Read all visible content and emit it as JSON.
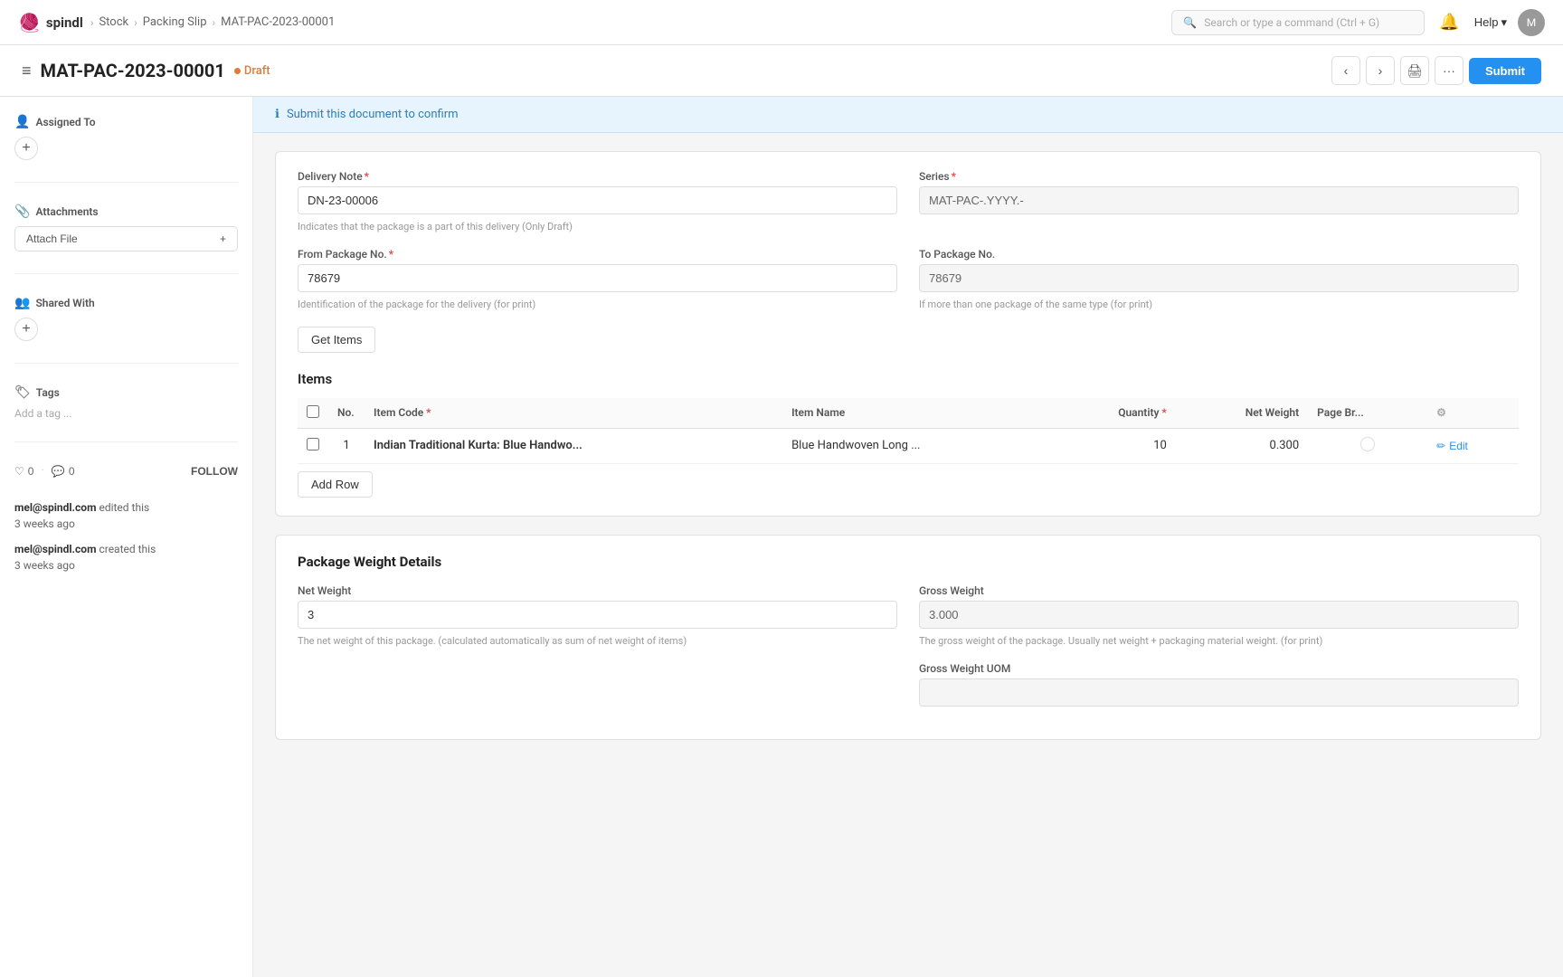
{
  "topnav": {
    "logo_text": "spindl",
    "logo_icon": "🧶",
    "breadcrumb": [
      {
        "label": "Stock",
        "href": "#"
      },
      {
        "label": "Packing Slip",
        "href": "#"
      },
      {
        "label": "MAT-PAC-2023-00001",
        "href": "#"
      }
    ],
    "search_placeholder": "Search or type a command (Ctrl + G)",
    "help_label": "Help",
    "avatar_text": "M"
  },
  "page_header": {
    "title": "MAT-PAC-2023-00001",
    "status": "Draft",
    "submit_label": "Submit"
  },
  "sidebar": {
    "assigned_to_label": "Assigned To",
    "attachments_label": "Attachments",
    "attach_file_label": "Attach File",
    "shared_with_label": "Shared With",
    "tags_label": "Tags",
    "add_tag_placeholder": "Add a tag ...",
    "likes_count": "0",
    "comments_count": "0",
    "follow_label": "FOLLOW",
    "activity": [
      {
        "user": "mel@spindl.com",
        "action": "edited this",
        "time": "3 weeks ago"
      },
      {
        "user": "mel@spindl.com",
        "action": "created this",
        "time": "3 weeks ago"
      }
    ]
  },
  "notice": {
    "text": "Submit this document to confirm"
  },
  "delivery_note": {
    "label": "Delivery Note",
    "value": "DN-23-00006",
    "hint": "Indicates that the package is a part of this delivery (Only Draft)"
  },
  "series": {
    "label": "Series",
    "value": "MAT-PAC-.YYYY.-"
  },
  "from_package_no": {
    "label": "From Package No.",
    "value": "78679",
    "hint": "Identification of the package for the delivery (for print)"
  },
  "to_package_no": {
    "label": "To Package No.",
    "value": "78679",
    "hint": "If more than one package of the same type (for print)"
  },
  "get_items_label": "Get Items",
  "items_section": {
    "title": "Items",
    "columns": [
      "No.",
      "Item Code",
      "Item Name",
      "Quantity",
      "Net Weight",
      "Page Br..."
    ],
    "rows": [
      {
        "no": "1",
        "item_code": "Indian Traditional Kurta: Blue Handwo...",
        "item_name": "Blue Handwoven Long ...",
        "quantity": "10",
        "net_weight": "0.300",
        "page_break": ""
      }
    ],
    "add_row_label": "Add Row",
    "edit_label": "Edit"
  },
  "package_weight": {
    "section_title": "Package Weight Details",
    "net_weight_label": "Net Weight",
    "net_weight_value": "3",
    "net_weight_hint": "The net weight of this package. (calculated automatically as sum of net weight of items)",
    "gross_weight_label": "Gross Weight",
    "gross_weight_value": "3.000",
    "gross_weight_hint": "The gross weight of the package. Usually net weight + packaging material weight. (for print)",
    "gross_weight_uom_label": "Gross Weight UOM",
    "gross_weight_uom_value": ""
  }
}
